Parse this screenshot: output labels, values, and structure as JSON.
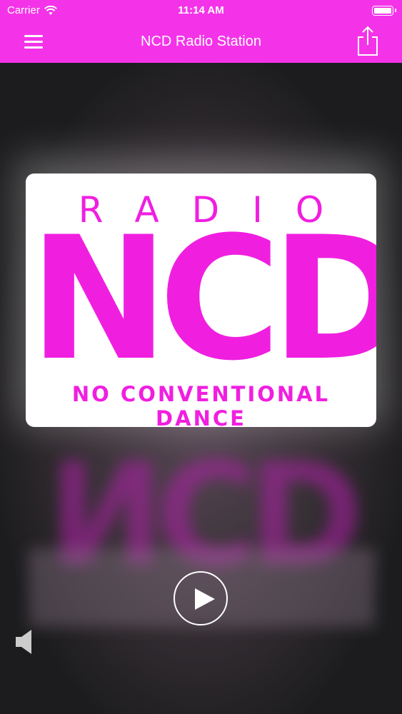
{
  "status_bar": {
    "carrier": "Carrier",
    "time": "11:14 AM",
    "icons": [
      "wifi-icon",
      "battery-icon"
    ]
  },
  "nav_bar": {
    "title": "NCD Radio Station",
    "left_icon": "menu-icon",
    "right_icon": "share-icon",
    "background": "#f433e9"
  },
  "logo": {
    "top_text": "RADIO",
    "main_text": "NCD",
    "bottom_text": "NO CONVENTIONAL DANCE",
    "color": "#f01fe0"
  },
  "player": {
    "play_icon": "play-icon",
    "volume_icon": "volume-icon"
  }
}
